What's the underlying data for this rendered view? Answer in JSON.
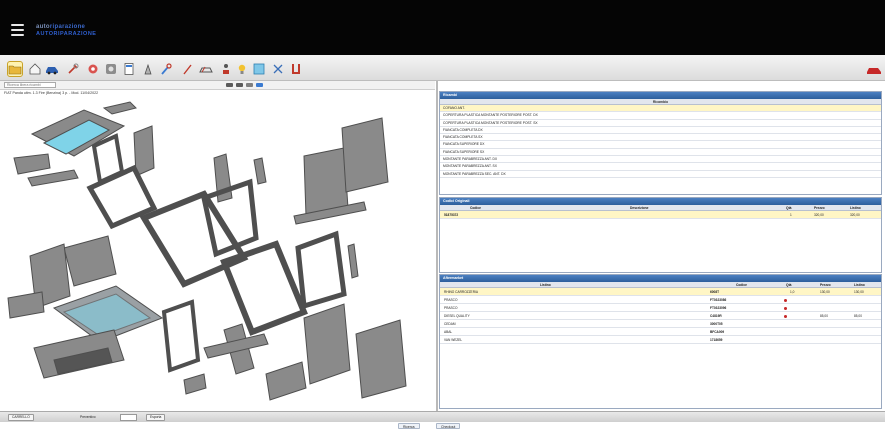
{
  "header": {
    "logo_line1_a": "auto",
    "logo_line1_b": "riparazione",
    "logo_line2": "AUTORIPARAZIONE"
  },
  "colors": {
    "topbar": "#050505",
    "panel_header": "#2d5f9c",
    "selected_row": "#fff6c5",
    "parts": "#8a8a8a",
    "highlight": "#7fd3e8"
  },
  "toolbar": {
    "icons": [
      "folder-icon",
      "home-icon",
      "car-side-icon",
      "tools-icon",
      "gear-wheel-icon",
      "disc-icon",
      "calculator-icon",
      "jack-icon",
      "wrench-icon",
      "pen-icon",
      "car-outline-icon",
      "person-icon",
      "lightbulb-icon",
      "target-icon",
      "scissors-icon",
      "seat-icon"
    ],
    "search_placeholder": "Ricerca libera ricambi"
  },
  "breadcrumb": "FIAT Panda ultm. 1.3 Fire (Benzina) 3 p. - Mod. 11/04/2022",
  "parts_panel": {
    "title": "Ricambi",
    "column": "Ricambio",
    "items": [
      "COFANO ANT.",
      "COPERTURA PLASTICA MONTANTE POSTERIORE POST. DX",
      "COPERTURA PLASTICA MONTANTE POSTERIORE POST. SX",
      "FIANCATA COMPLETA DX",
      "FIANCATA COMPLETA SX",
      "FIANCATA SUPERIORE DX",
      "FIANCATA SUPERIORE SX",
      "MONTANTE PARABREZZA ANT. DX",
      "MONTANTE PARABREZZA ANT. SX",
      "MONTANTE PARABREZZA SEC. ANT. DX"
    ]
  },
  "original_panel": {
    "title": "Codici Originali",
    "columns": [
      "Codice",
      "Descrizione",
      "Qtà",
      "Prezzo",
      "Listino"
    ],
    "rows": [
      {
        "code": "51875372",
        "desc": "",
        "qty": "1",
        "prezzo": "320,00",
        "listino": "320,00"
      }
    ]
  },
  "aftermarket_panel": {
    "title": "Aftermarket",
    "columns": [
      "Listino",
      "Codice",
      "Qtà",
      "Prezzo",
      "Listino"
    ],
    "rows": [
      {
        "name": "RHINO CARROZZERIA",
        "code": "6008T",
        "qty": "1,0",
        "prezzo": "130,00",
        "listino": "130,00"
      },
      {
        "name": "PRASCO",
        "code": "FT0323086",
        "qty": "",
        "prezzo": "",
        "listino": ""
      },
      {
        "name": "PRASCO",
        "code": "FT0323096",
        "qty": "",
        "prezzo": "",
        "listino": ""
      },
      {
        "name": "DIESEL QUALITY",
        "code": "C4819R",
        "qty": "",
        "prezzo": "85,00",
        "listino": "85,00"
      },
      {
        "name": "CEDAM",
        "code": "3000T05",
        "qty": "",
        "prezzo": "",
        "listino": ""
      },
      {
        "name": "ABAL",
        "code": "BFCA009",
        "qty": "",
        "prezzo": "",
        "listino": ""
      },
      {
        "name": "VAN WEZEL",
        "code": "1718659",
        "qty": "",
        "prezzo": "",
        "listino": ""
      }
    ]
  },
  "bottombar": {
    "btn1": "CARRELLO",
    "lbl": "Preventivo",
    "btn2": "Esporta"
  },
  "footer": {
    "tab1": "Ricerca",
    "tab2": "Checkout"
  }
}
